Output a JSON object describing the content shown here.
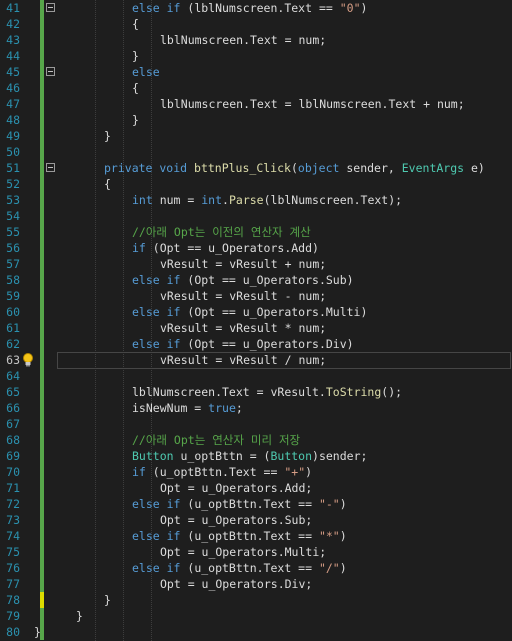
{
  "editor": {
    "current_line": 63,
    "colors": {
      "background": "#1e1e1e",
      "line_number": "#2b91af",
      "keyword": "#569cd6",
      "type": "#4ec9b0",
      "method": "#dcdcaa",
      "string": "#d69d85",
      "comment": "#57a64a",
      "text": "#dcdcdc",
      "change_bar_saved": "#57a64a",
      "change_bar_unsaved": "#dcdc00"
    },
    "lightbulb_icon": "lightbulb-icon",
    "lines": [
      {
        "n": "41",
        "indent": 7,
        "tokens": [
          [
            "k",
            "else if"
          ],
          [
            "v",
            " (lblNumscreen.Text == "
          ],
          [
            "s",
            "\"0\""
          ],
          [
            "v",
            ")"
          ]
        ],
        "fold": true
      },
      {
        "n": "42",
        "indent": 7,
        "tokens": [
          [
            "v",
            "{"
          ]
        ]
      },
      {
        "n": "43",
        "indent": 9,
        "tokens": [
          [
            "v",
            "lblNumscreen.Text = num;"
          ]
        ]
      },
      {
        "n": "44",
        "indent": 7,
        "tokens": [
          [
            "v",
            "}"
          ]
        ]
      },
      {
        "n": "45",
        "indent": 7,
        "tokens": [
          [
            "k",
            "else"
          ]
        ],
        "fold": true
      },
      {
        "n": "46",
        "indent": 7,
        "tokens": [
          [
            "v",
            "{"
          ]
        ]
      },
      {
        "n": "47",
        "indent": 9,
        "tokens": [
          [
            "v",
            "lblNumscreen.Text = lblNumscreen.Text + num;"
          ]
        ]
      },
      {
        "n": "48",
        "indent": 7,
        "tokens": [
          [
            "v",
            "}"
          ]
        ]
      },
      {
        "n": "49",
        "indent": 5,
        "tokens": [
          [
            "v",
            "}"
          ]
        ]
      },
      {
        "n": "50",
        "indent": 0,
        "tokens": []
      },
      {
        "n": "51",
        "indent": 5,
        "tokens": [
          [
            "k",
            "private void "
          ],
          [
            "m",
            "bttnPlus_Click"
          ],
          [
            "v",
            "("
          ],
          [
            "k",
            "object"
          ],
          [
            "v",
            " sender, "
          ],
          [
            "t",
            "EventArgs"
          ],
          [
            "v",
            " e)"
          ]
        ],
        "fold": true
      },
      {
        "n": "52",
        "indent": 5,
        "tokens": [
          [
            "v",
            "{"
          ]
        ]
      },
      {
        "n": "53",
        "indent": 7,
        "tokens": [
          [
            "k",
            "int"
          ],
          [
            "v",
            " num = "
          ],
          [
            "k",
            "int"
          ],
          [
            "v",
            "."
          ],
          [
            "m",
            "Parse"
          ],
          [
            "v",
            "(lblNumscreen.Text);"
          ]
        ]
      },
      {
        "n": "54",
        "indent": 0,
        "tokens": []
      },
      {
        "n": "55",
        "indent": 7,
        "tokens": [
          [
            "c",
            "//아래 Opt는 이전의 연산자 계산"
          ]
        ]
      },
      {
        "n": "56",
        "indent": 7,
        "tokens": [
          [
            "k",
            "if"
          ],
          [
            "v",
            " (Opt == u_Operators.Add)"
          ]
        ]
      },
      {
        "n": "57",
        "indent": 9,
        "tokens": [
          [
            "v",
            "vResult = vResult + num;"
          ]
        ]
      },
      {
        "n": "58",
        "indent": 7,
        "tokens": [
          [
            "k",
            "else if"
          ],
          [
            "v",
            " (Opt == u_Operators.Sub)"
          ]
        ]
      },
      {
        "n": "59",
        "indent": 9,
        "tokens": [
          [
            "v",
            "vResult = vResult - num;"
          ]
        ]
      },
      {
        "n": "60",
        "indent": 7,
        "tokens": [
          [
            "k",
            "else if"
          ],
          [
            "v",
            " (Opt == u_Operators.Multi)"
          ]
        ]
      },
      {
        "n": "61",
        "indent": 9,
        "tokens": [
          [
            "v",
            "vResult = vResult * num;"
          ]
        ]
      },
      {
        "n": "62",
        "indent": 7,
        "tokens": [
          [
            "k",
            "else if"
          ],
          [
            "v",
            " (Opt == u_Operators.Div)"
          ]
        ]
      },
      {
        "n": "63",
        "indent": 9,
        "tokens": [
          [
            "v",
            "vResult = vResult / num;"
          ]
        ],
        "current": true
      },
      {
        "n": "64",
        "indent": 0,
        "tokens": []
      },
      {
        "n": "65",
        "indent": 7,
        "tokens": [
          [
            "v",
            "lblNumscreen.Text = vResult."
          ],
          [
            "m",
            "ToString"
          ],
          [
            "v",
            "();"
          ]
        ]
      },
      {
        "n": "66",
        "indent": 7,
        "tokens": [
          [
            "v",
            "isNewNum = "
          ],
          [
            "k",
            "true"
          ],
          [
            "v",
            ";"
          ]
        ]
      },
      {
        "n": "67",
        "indent": 0,
        "tokens": []
      },
      {
        "n": "68",
        "indent": 7,
        "tokens": [
          [
            "c",
            "//아래 Opt는 연산자 미리 저장"
          ]
        ]
      },
      {
        "n": "69",
        "indent": 7,
        "tokens": [
          [
            "t",
            "Button"
          ],
          [
            "v",
            " u_optBttn = ("
          ],
          [
            "t",
            "Button"
          ],
          [
            "v",
            ")sender;"
          ]
        ]
      },
      {
        "n": "70",
        "indent": 7,
        "tokens": [
          [
            "k",
            "if"
          ],
          [
            "v",
            " (u_optBttn.Text == "
          ],
          [
            "s",
            "\"+\""
          ],
          [
            "v",
            ")"
          ]
        ]
      },
      {
        "n": "71",
        "indent": 9,
        "tokens": [
          [
            "v",
            "Opt = u_Operators.Add;"
          ]
        ]
      },
      {
        "n": "72",
        "indent": 7,
        "tokens": [
          [
            "k",
            "else if"
          ],
          [
            "v",
            " (u_optBttn.Text == "
          ],
          [
            "s",
            "\"-\""
          ],
          [
            "v",
            ")"
          ]
        ]
      },
      {
        "n": "73",
        "indent": 9,
        "tokens": [
          [
            "v",
            "Opt = u_Operators.Sub;"
          ]
        ]
      },
      {
        "n": "74",
        "indent": 7,
        "tokens": [
          [
            "k",
            "else if"
          ],
          [
            "v",
            " (u_optBttn.Text == "
          ],
          [
            "s",
            "\"*\""
          ],
          [
            "v",
            ")"
          ]
        ]
      },
      {
        "n": "75",
        "indent": 9,
        "tokens": [
          [
            "v",
            "Opt = u_Operators.Multi;"
          ]
        ]
      },
      {
        "n": "76",
        "indent": 7,
        "tokens": [
          [
            "k",
            "else if"
          ],
          [
            "v",
            " (u_optBttn.Text == "
          ],
          [
            "s",
            "\"/\""
          ],
          [
            "v",
            ")"
          ]
        ]
      },
      {
        "n": "77",
        "indent": 9,
        "tokens": [
          [
            "v",
            "Opt = u_Operators.Div;"
          ]
        ]
      },
      {
        "n": "78",
        "indent": 5,
        "tokens": [
          [
            "v",
            "}"
          ]
        ],
        "unsaved": true
      },
      {
        "n": "79",
        "indent": 3,
        "tokens": [
          [
            "v",
            "}"
          ]
        ]
      },
      {
        "n": "80",
        "indent": 0,
        "tokens": [
          [
            "v",
            "}"
          ]
        ]
      }
    ]
  }
}
